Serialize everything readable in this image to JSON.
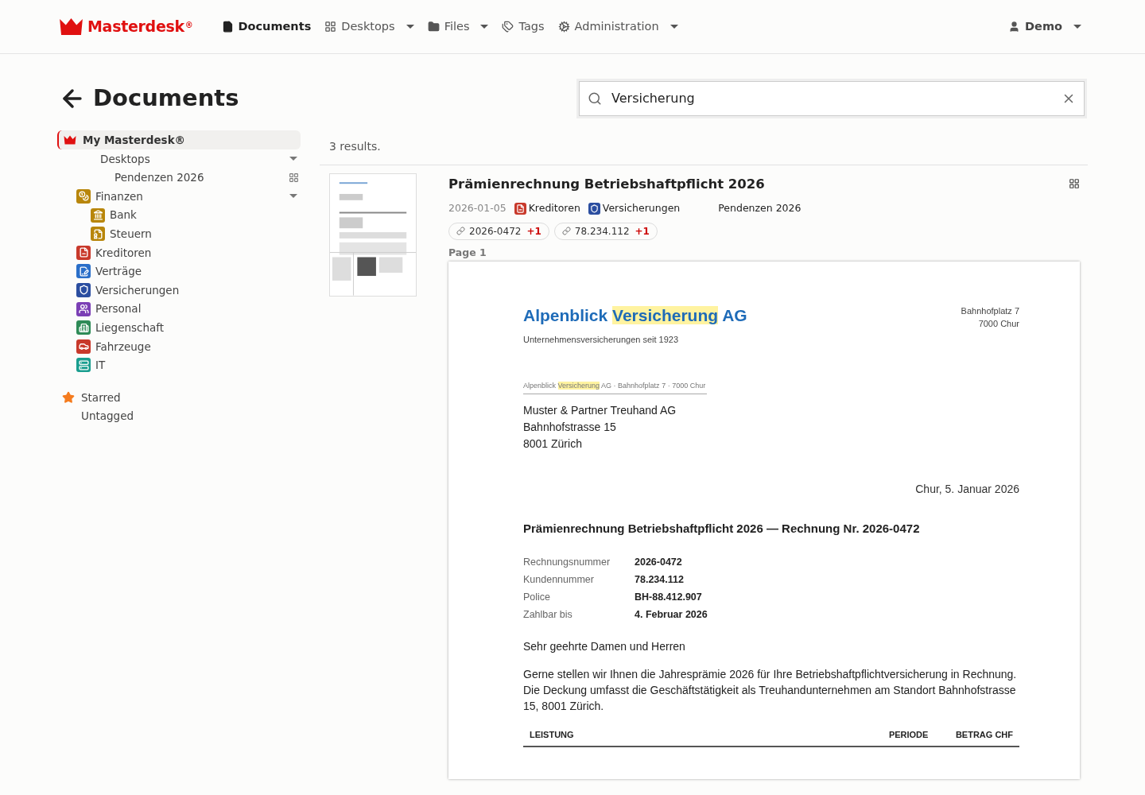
{
  "navbar": {
    "brand": "Masterdesk",
    "brand_mark": "®",
    "items": [
      {
        "label": "Documents",
        "selected": true,
        "dropdown": false
      },
      {
        "label": "Desktops",
        "selected": false,
        "dropdown": true
      },
      {
        "label": "Files",
        "selected": false,
        "dropdown": true
      },
      {
        "label": "Tags",
        "selected": false,
        "dropdown": false
      },
      {
        "label": "Administration",
        "selected": false,
        "dropdown": true
      }
    ],
    "user": "Demo"
  },
  "page_title": "Documents",
  "search": {
    "value": "Versicherung"
  },
  "sidebar": {
    "root": {
      "label": "My Masterdesk®",
      "selected": true,
      "children": [
        {
          "label": "Desktops",
          "expanded": true,
          "children": [
            {
              "label": "Pendenzen 2026"
            }
          ]
        },
        {
          "label": "Finanzen",
          "color": "#b8860b",
          "expanded": true,
          "children": [
            {
              "label": "Bank",
              "color": "#b8860b"
            },
            {
              "label": "Steuern",
              "color": "#b8860b"
            }
          ]
        },
        {
          "label": "Kreditoren",
          "color": "#c8392b"
        },
        {
          "label": "Verträge",
          "color": "#2a6fc9"
        },
        {
          "label": "Versicherungen",
          "color": "#2b4ea0"
        },
        {
          "label": "Personal",
          "color": "#7b3fb5"
        },
        {
          "label": "Liegenschaft",
          "color": "#2e8b57"
        },
        {
          "label": "Fahrzeuge",
          "color": "#c8392b"
        },
        {
          "label": "IT",
          "color": "#1a9e8f"
        }
      ]
    },
    "extra": [
      {
        "label": "Starred",
        "starred": true
      },
      {
        "label": "Untagged",
        "starred": false
      }
    ]
  },
  "results": {
    "count": "3 results.",
    "items": [
      {
        "title": "Prämienrechnung Betriebshaftpflicht 2026",
        "date": "2026-01-05",
        "tags": [
          {
            "label": "Kreditoren",
            "color": "#c8392b"
          },
          {
            "label": "Versicherungen",
            "color": "#2b4ea0"
          }
        ],
        "desktop": "Pendenzen 2026",
        "links": [
          {
            "label": "2026-0472",
            "extra": "+1"
          },
          {
            "label": "78.234.112",
            "extra": "+1"
          }
        ],
        "page_label": "Page 1",
        "document": {
          "company": [
            "Alpenblick ",
            "Versicherung",
            " AG"
          ],
          "tagline": "Unternehmensversicherungen seit 1923",
          "sender_address": [
            "Bahnhofplatz 7",
            "7000 Chur"
          ],
          "return_line": [
            "Alpenblick ",
            "Versicherung",
            " AG · Bahnhofplatz 7 · 7000 Chur"
          ],
          "recipient": [
            "Muster & Partner Treuhand AG",
            "Bahnhofstrasse 15",
            "8001 Zürich"
          ],
          "place_date": "Chur, 5. Januar 2026",
          "subject": "Prämienrechnung Betriebshaftpflicht 2026 — Rechnung Nr. 2026-0472",
          "fields": [
            {
              "label": "Rechnungsnummer",
              "value": "2026-0472"
            },
            {
              "label": "Kundennummer",
              "value": "78.234.112"
            },
            {
              "label": "Police",
              "value": "BH-88.412.907"
            },
            {
              "label": "Zahlbar bis",
              "value": "4. Februar 2026"
            }
          ],
          "salutation": "Sehr geehrte Damen und Herren",
          "body": "Gerne stellen wir Ihnen die Jahresprämie 2026 für Ihre Betriebshaftpflichtversicherung in Rechnung. Die Deckung umfasst die Geschäftstätigkeit als Treuhandunternehmen am Standort Bahnhofstrasse 15, 8001 Zürich.",
          "table_columns": [
            "LEISTUNG",
            "PERIODE",
            "BETRAG CHF"
          ]
        }
      }
    ]
  }
}
